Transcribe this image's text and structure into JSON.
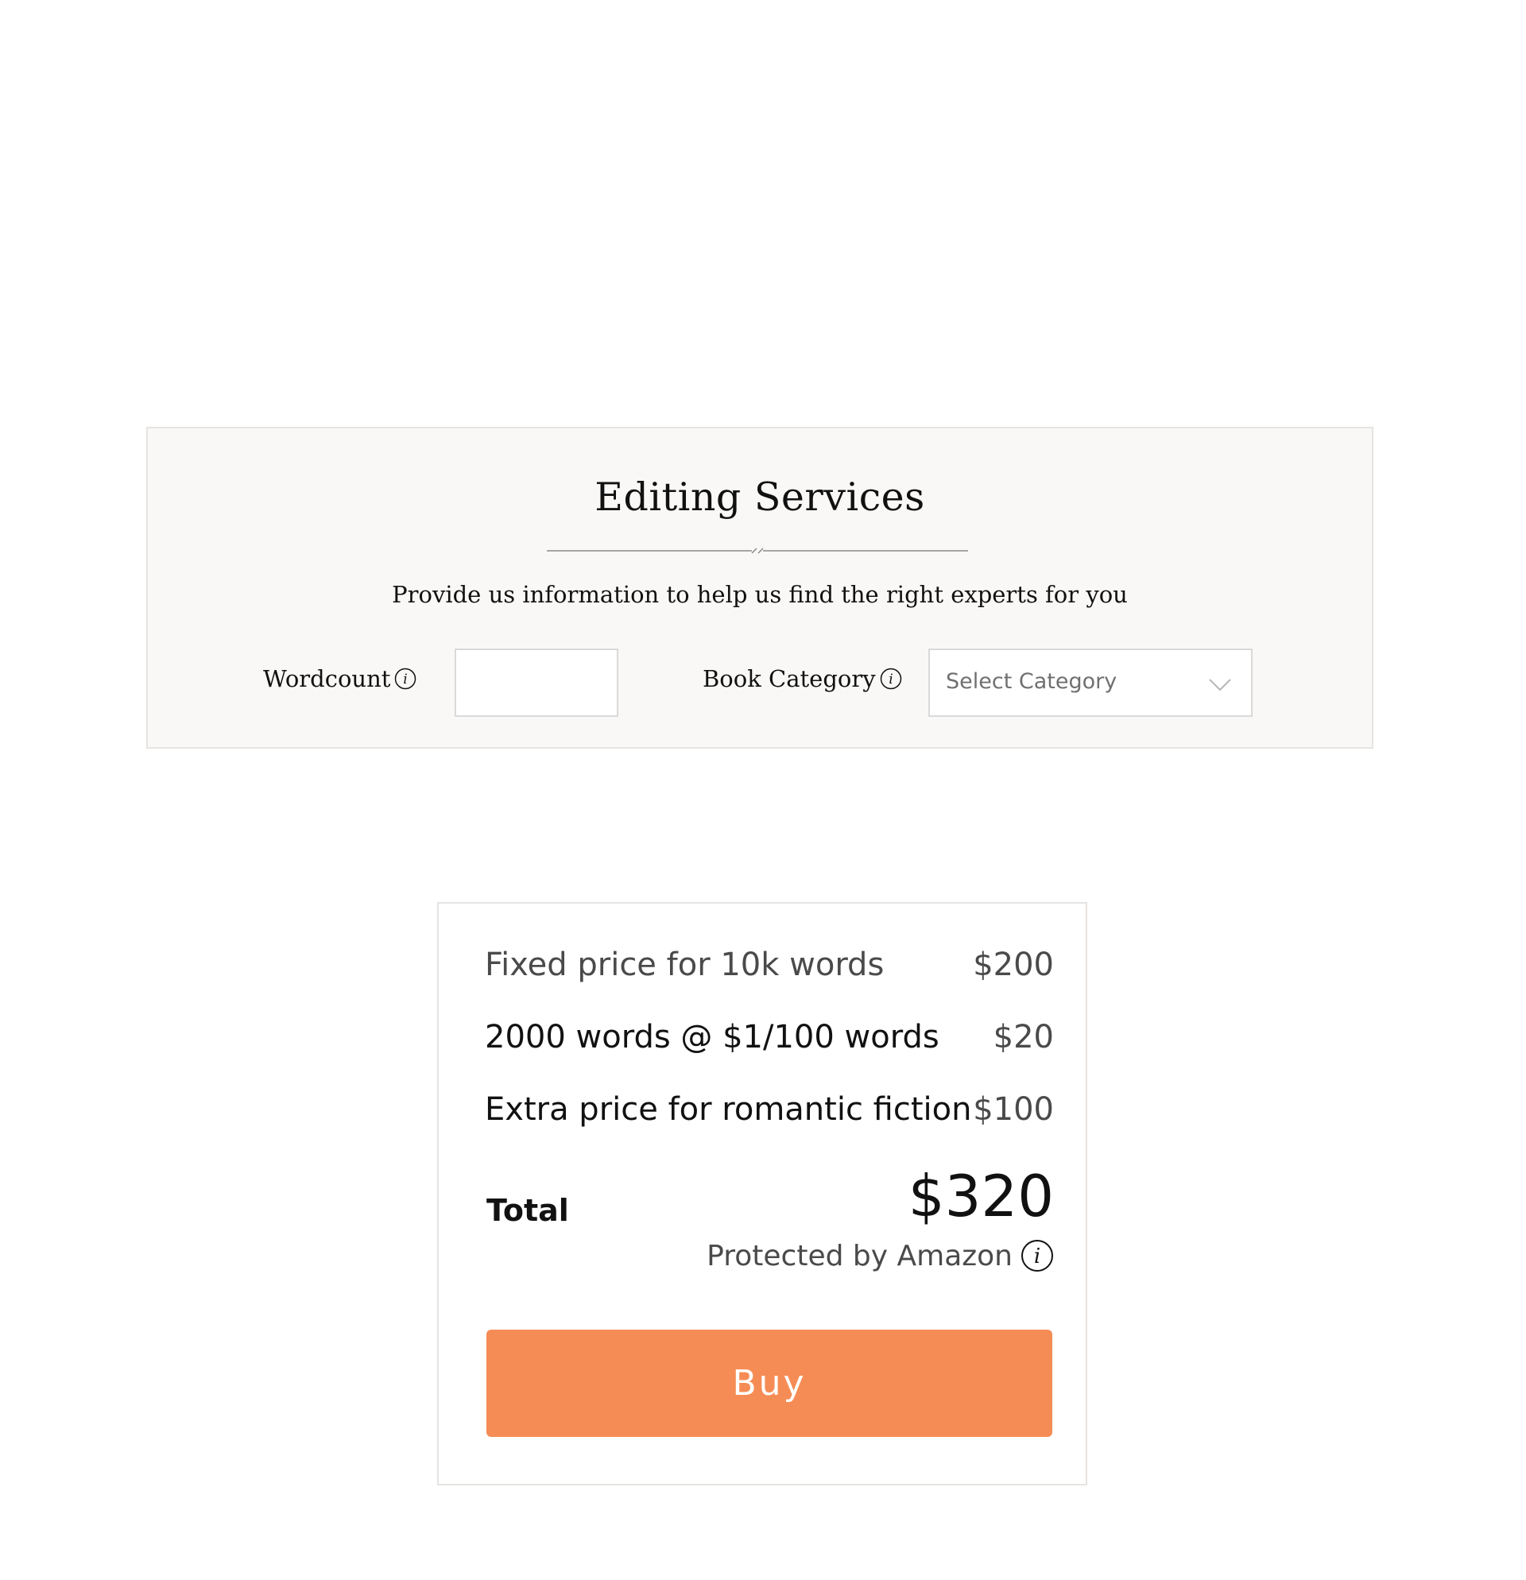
{
  "services": {
    "title": "Editing Services",
    "subtitle": "Provide us information to help us find the right experts for you",
    "wordcount_label": "Wordcount",
    "wordcount_value": "",
    "category_label": "Book Category",
    "category_placeholder": "Select Category"
  },
  "pricing": {
    "rows": [
      {
        "label": "Fixed price for 10k words",
        "amount": "$200"
      },
      {
        "label": "2000 words @ $1/100 words",
        "amount": "$20"
      },
      {
        "label": "Extra price for romantic fiction",
        "amount": "$100"
      }
    ],
    "total_label": "Total",
    "total_amount": "$320",
    "protected_text": "Protected by Amazon",
    "buy_label": "Buy"
  },
  "icons": {
    "info": "info-icon",
    "dropdown": "chevron-down-icon",
    "divider": "divider-ornament"
  },
  "colors": {
    "buy_button": "#f68c55",
    "panel_background": "#f9f8f6",
    "border": "#e6e4e1"
  }
}
